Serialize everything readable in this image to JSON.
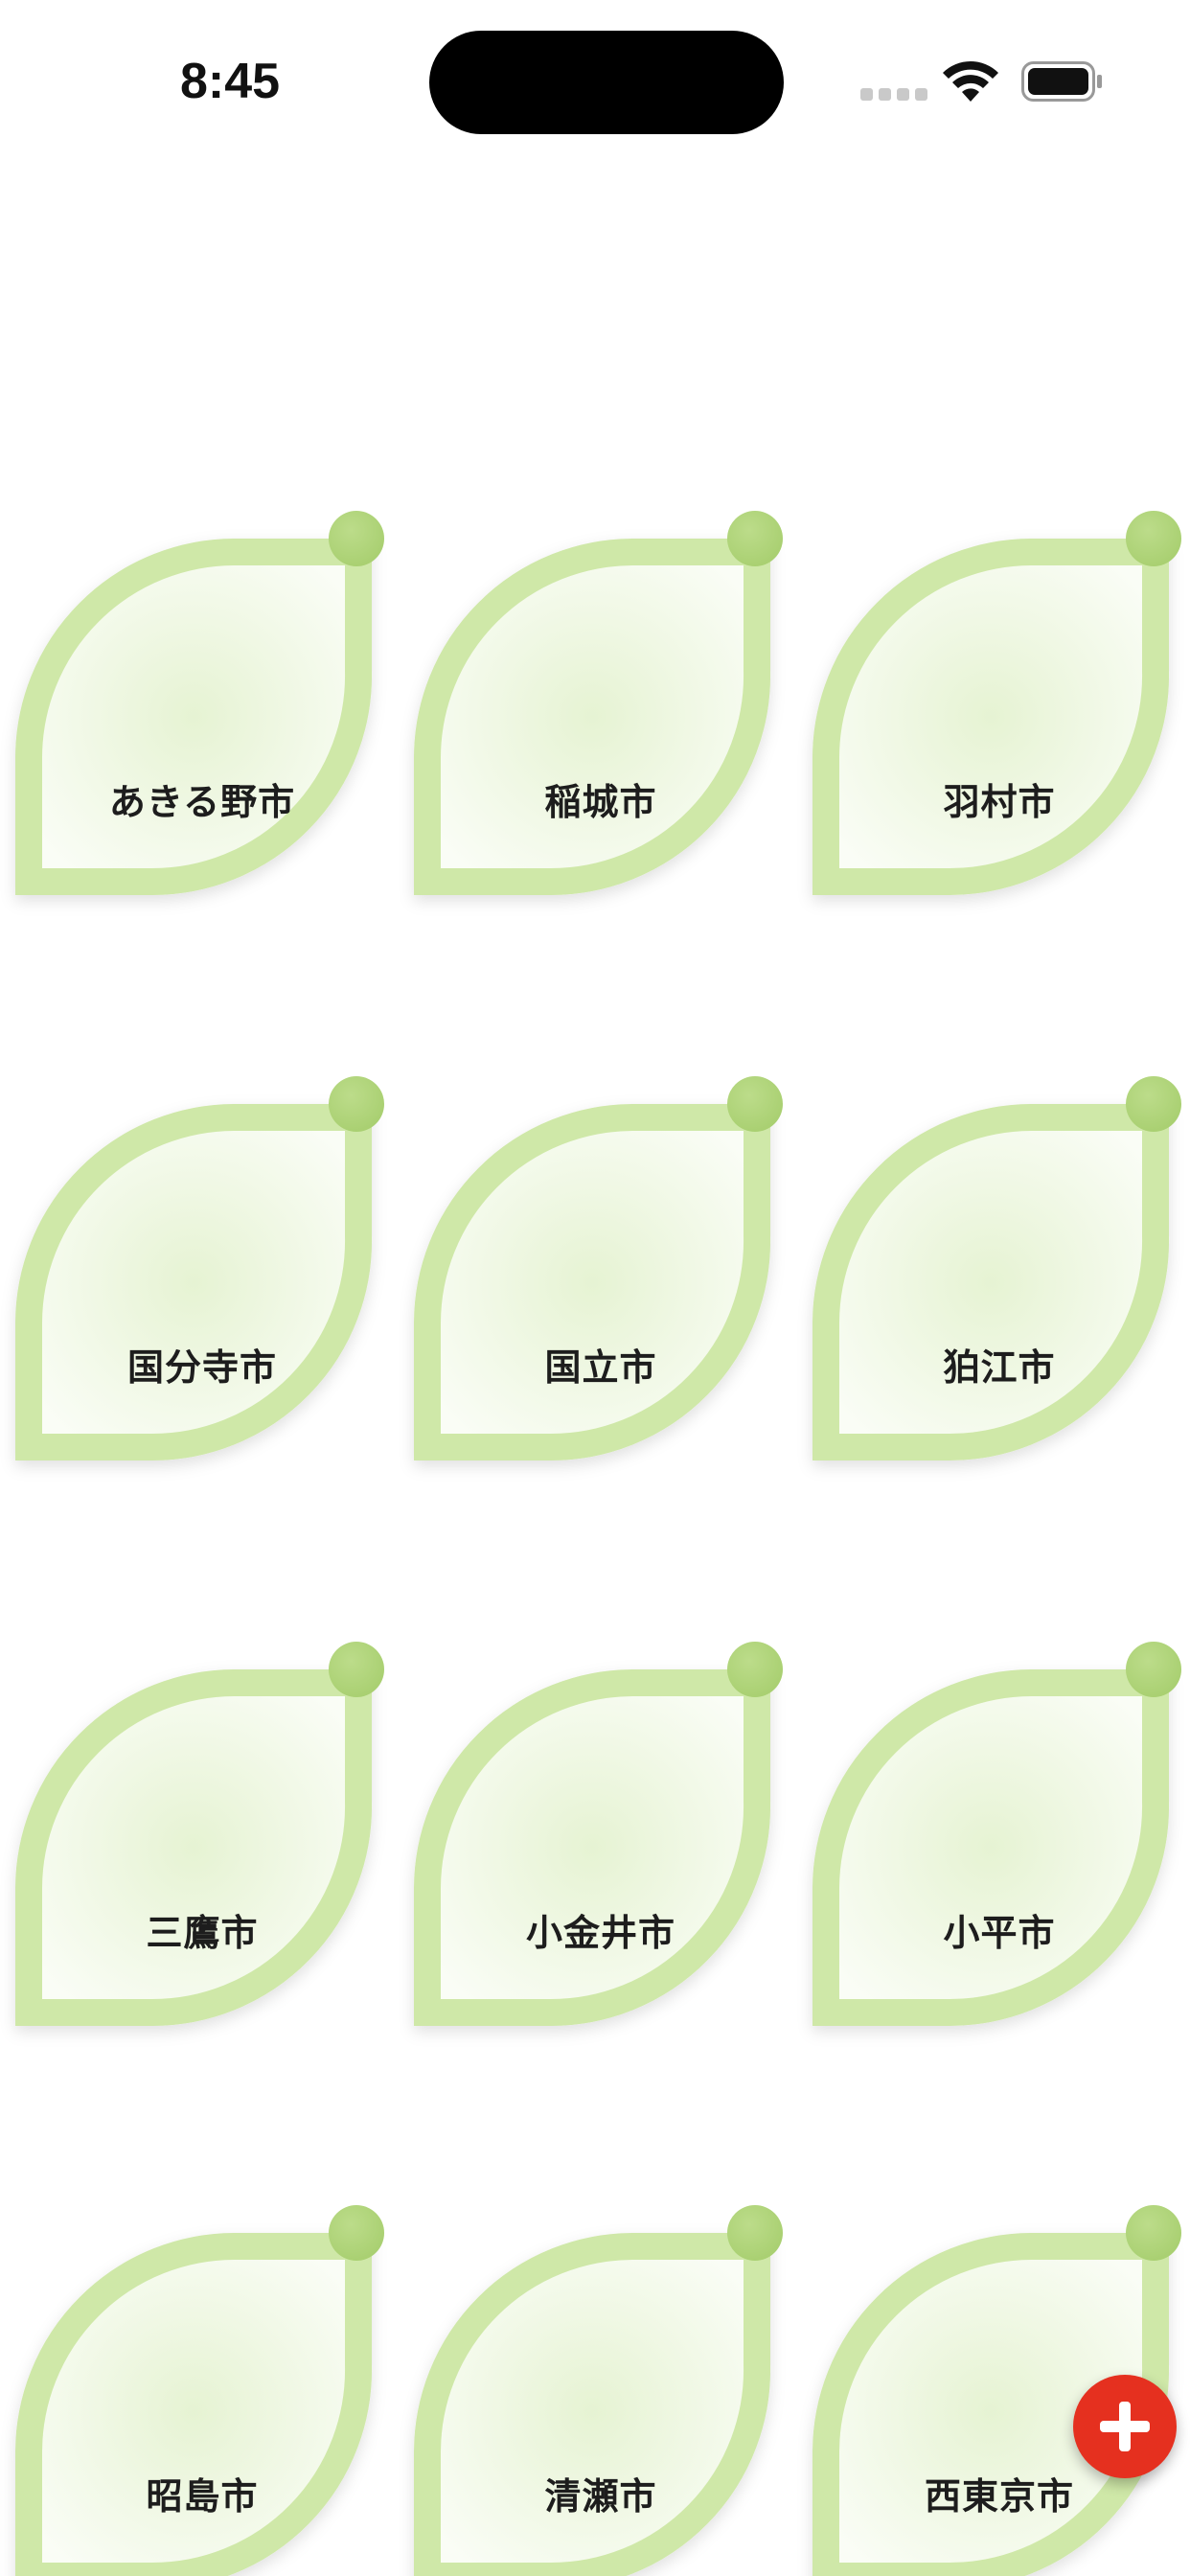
{
  "status_bar": {
    "time": "8:45"
  },
  "cities": [
    {
      "name": "あきる野市"
    },
    {
      "name": "稲城市"
    },
    {
      "name": "羽村市"
    },
    {
      "name": "国分寺市"
    },
    {
      "name": "国立市"
    },
    {
      "name": "狛江市"
    },
    {
      "name": "三鷹市"
    },
    {
      "name": "小金井市"
    },
    {
      "name": "小平市"
    },
    {
      "name": "昭島市"
    },
    {
      "name": "清瀬市"
    },
    {
      "name": "西東京市"
    }
  ],
  "colors": {
    "leaf_border": "#cfe8a8",
    "leaf_fill_center": "#e6f3d3",
    "leaf_fill_edge": "#fafdf6",
    "dot": "#a8cf70",
    "fab": "#e5301f"
  },
  "fab": {
    "icon": "plus-icon"
  }
}
